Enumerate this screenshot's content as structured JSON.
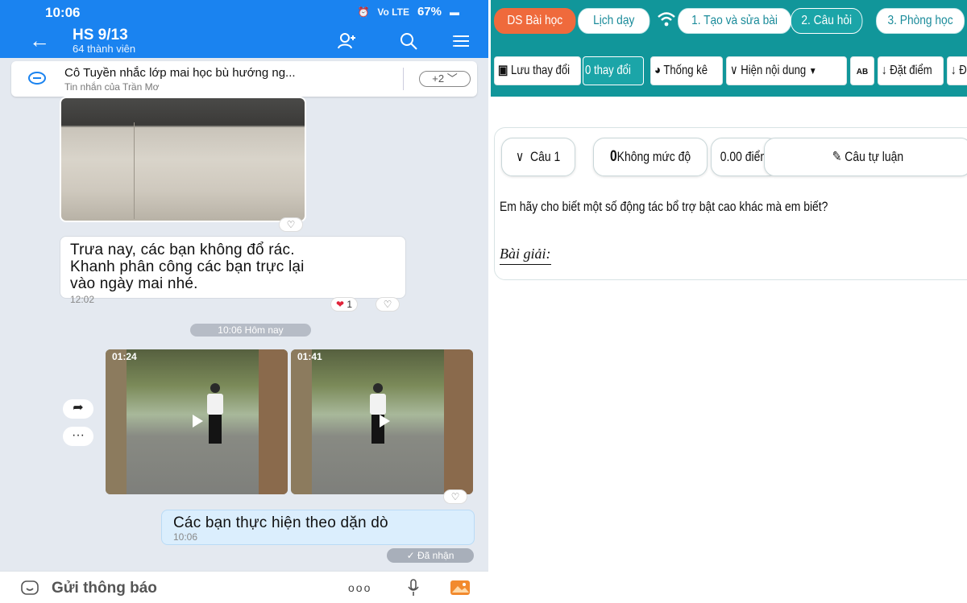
{
  "chat": {
    "status": {
      "time": "10:06",
      "network": "Vo LTE",
      "battery": "67%"
    },
    "header": {
      "title": "HS 9/13",
      "members": "64 thành viên"
    },
    "pinned": {
      "title": "Cô Tuyền nhắc lớp mai học bù hướng ng...",
      "sub": "Tin nhắn của Trần Mơ",
      "more": "+2 ﹀"
    },
    "messages": [
      {
        "text": "Trưa nay, các bạn không đổ rác.\nKhanh phân công các bạn trực lại\nvào ngày mai nhé.",
        "time": "12:02",
        "reaction_count": "1"
      },
      {
        "text": "Các bạn thực hiện theo dặn dò",
        "time": "10:06"
      }
    ],
    "day_separator": "10:06 Hôm nay",
    "videos": [
      {
        "duration": "01:24"
      },
      {
        "duration": "01:41"
      }
    ],
    "received": "✓ Đã nhận",
    "compose_placeholder": "Gửi thông báo",
    "more_dots": "ooo"
  },
  "lms": {
    "tabs": [
      "DS Bài học",
      "Lịch dạy",
      "1. Tạo và sửa bài",
      "2. Câu hỏi",
      "3. Phòng học"
    ],
    "toolbar": {
      "save": "Lưu thay đổi",
      "changes": "0 thay đổi",
      "stats": "Thống kê",
      "show": "Hiện nội dung",
      "ab": "AB",
      "set_score": "Đặt điểm",
      "next": "Đ"
    },
    "question": {
      "label": "Câu 1",
      "level_num": "0",
      "level": "Không mức độ",
      "score": "0.00 điểm",
      "type": "Câu tự luận",
      "text": "Em hãy cho biết một số động tác bổ trợ bật cao khác mà em biết?",
      "solution_label": "Bài giải:"
    }
  },
  "colors": {
    "zalo_blue": "#1a83f0",
    "lms_teal": "#11969a",
    "tab_orange": "#ef6a3c"
  }
}
